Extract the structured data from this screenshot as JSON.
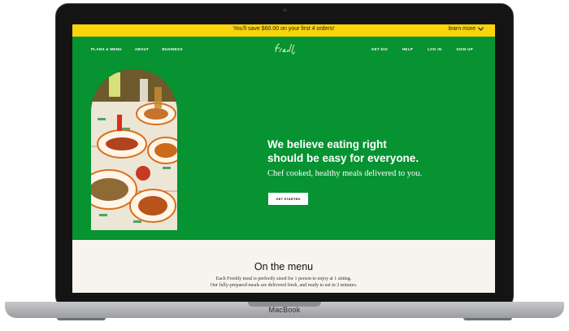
{
  "promo": {
    "text": "You'll save $60.00 on your first 4 orders!",
    "link_label": "learn more"
  },
  "nav": {
    "left": [
      "PLANS & MENU",
      "ABOUT",
      "BUSINESS"
    ],
    "right": [
      "GET $10",
      "HELP",
      "LOG IN",
      "SIGN UP"
    ],
    "logo_text": "Freshly"
  },
  "hero": {
    "headline_line1": "We believe eating right",
    "headline_line2": "should be easy for everyone.",
    "subhead": "Chef cooked, healthy meals delivered to you.",
    "cta_label": "GET STARTED"
  },
  "menu": {
    "title": "On the menu",
    "description_line1": "Each Freshly meal is perfectly sized for 1 person to enjoy at 1 sitting.",
    "description_line2": "Our fully-prepared meals are delivered fresh, and ready to eat in 3 minutes."
  },
  "device": {
    "brand": "MacBook"
  },
  "colors": {
    "hero_green": "#079331",
    "promo_yellow": "#f9d40b",
    "page_cream": "#f7f4ed"
  },
  "icons": {
    "learn_more": "chevron-down-icon",
    "food_photo": "mexican-dishes-photo"
  }
}
